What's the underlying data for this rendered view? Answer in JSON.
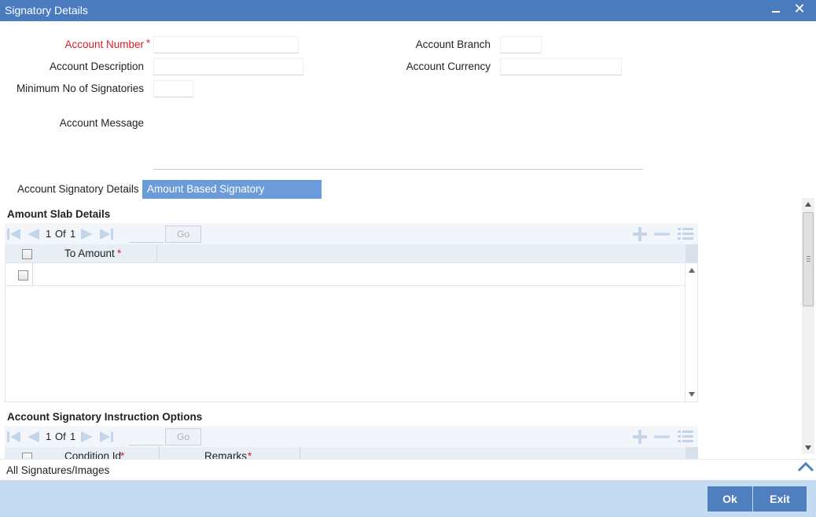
{
  "window": {
    "title": "Signatory Details"
  },
  "form": {
    "account_number_label": "Account Number",
    "required_mark": "*",
    "account_description_label": "Account Description",
    "min_signatories_label": "Minimum No of Signatories",
    "account_message_label": "Account Message",
    "account_branch_label": "Account Branch",
    "account_currency_label": "Account Currency",
    "account_number_value": "",
    "account_description_value": "",
    "min_signatories_value": "",
    "account_branch_value": "",
    "account_currency_value": ""
  },
  "tabs": [
    {
      "label": "Account Signatory Details",
      "active": false
    },
    {
      "label": "Amount Based Signatory Instructions",
      "active": true
    }
  ],
  "amount_slab": {
    "title": "Amount Slab Details",
    "page_current": "1",
    "page_of": "Of",
    "page_total": "1",
    "go_label": "Go",
    "col_to_amount": "To Amount",
    "required_mark": "*",
    "row_value": ""
  },
  "instruction_options": {
    "title": "Account Signatory Instruction Options",
    "page_current": "1",
    "page_of": "Of",
    "page_total": "1",
    "go_label": "Go",
    "col_condition_id": "Condition Id",
    "col_remarks": "Remarks",
    "required_mark": "*"
  },
  "footer": {
    "all_signatures_label": "All Signatures/Images",
    "ok_label": "Ok",
    "exit_label": "Exit"
  },
  "colors": {
    "title_bar": "#4a7bbf",
    "active_tab": "#6b9bd8",
    "footer": "#c4dbf1",
    "button": "#4f7fbf",
    "required": "#d0202a"
  }
}
